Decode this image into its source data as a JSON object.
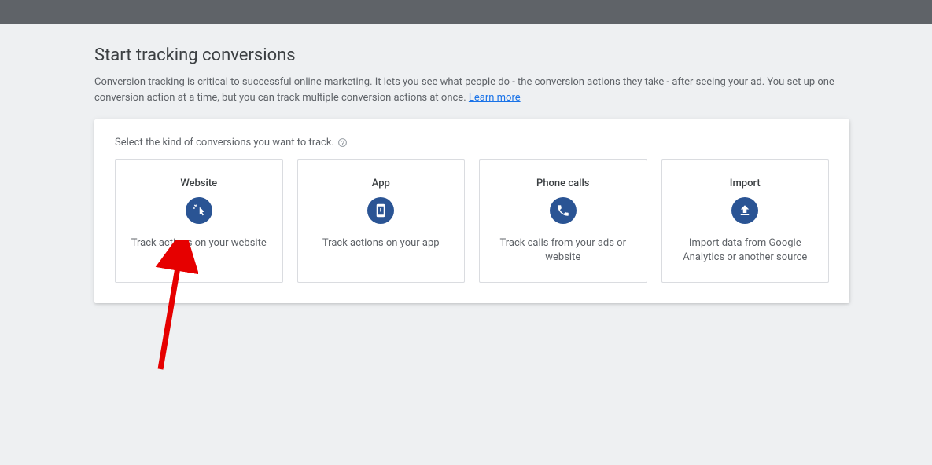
{
  "header": {
    "title": "Start tracking conversions",
    "description": "Conversion tracking is critical to successful online marketing. It lets you see what people do - the conversion actions they take - after seeing your ad. You set up one conversion action at a time, but you can track multiple conversion actions at once.  ",
    "learn_more": "Learn more"
  },
  "panel": {
    "select_label": "Select the kind of conversions you want to track.",
    "options": [
      {
        "title": "Website",
        "desc": "Track actions on your website",
        "icon": "cursor-click-icon"
      },
      {
        "title": "App",
        "desc": "Track actions on your app",
        "icon": "smartphone-icon"
      },
      {
        "title": "Phone calls",
        "desc": "Track calls from your ads or website",
        "icon": "phone-icon"
      },
      {
        "title": "Import",
        "desc": "Import data from Google Analytics or another source",
        "icon": "upload-icon"
      }
    ]
  },
  "colors": {
    "icon_bg": "#2a5494",
    "link": "#1a73e8",
    "text": "#3c4043",
    "muted": "#5f6368"
  },
  "annotation": {
    "arrow_points_to_option_index": 0
  }
}
